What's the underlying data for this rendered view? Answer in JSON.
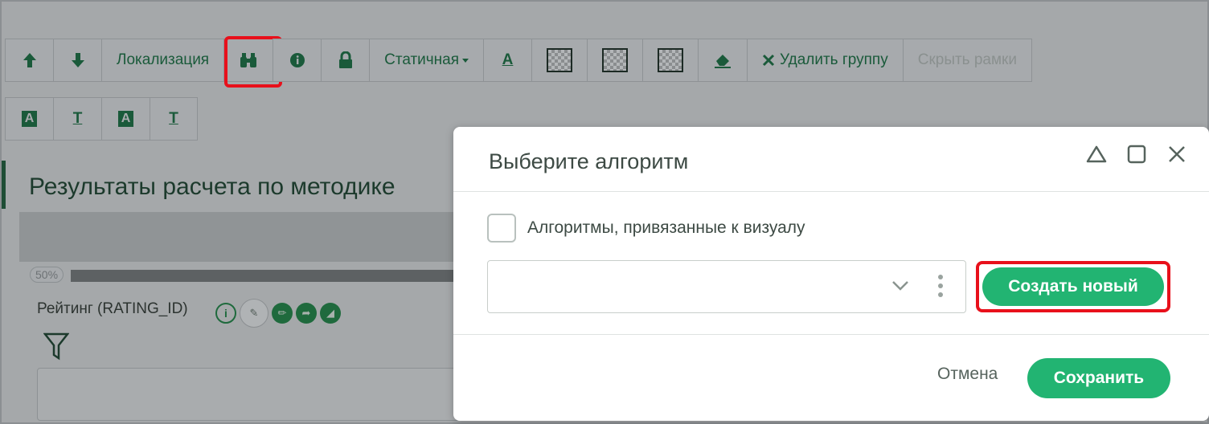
{
  "toolbar": {
    "localization_label": "Локализация",
    "static_label": "Статичная",
    "delete_group_label": "Удалить группу",
    "hide_frames_label": "Скрыть рамки",
    "underline_a": "A",
    "underline_t": "T"
  },
  "background": {
    "section_title": "Результаты расчета по методике",
    "progress_text": "50%",
    "progress_value": 0.5,
    "rating_label": "Рейтинг (RATING_ID)"
  },
  "modal": {
    "title": "Выберите алгоритм",
    "checkbox_label": "Алгоритмы, привязанные к визуалу",
    "checkbox_checked": false,
    "select_value": "",
    "create_button": "Создать новый",
    "cancel_button": "Отмена",
    "save_button": "Сохранить"
  },
  "colors": {
    "accent_green": "#22b472",
    "highlight_red": "#e8101b",
    "overlay_grey": "#a5a8aa"
  }
}
